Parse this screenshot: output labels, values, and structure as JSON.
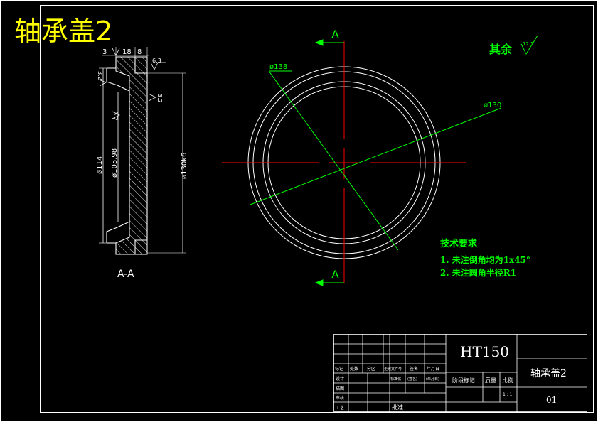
{
  "title": "轴承盖2",
  "colors": {
    "background": "#000000",
    "line": "#ffffff",
    "center": "#ff0000",
    "dim": "#00ff00",
    "title": "#ffff00"
  },
  "section_view": {
    "label": "A-A",
    "dims_top": [
      "3",
      "18",
      "8"
    ],
    "roughness_top": "6.3",
    "roughness_left": "3.2",
    "roughness_mid": "3.2",
    "roughness_right": "3.2",
    "dim_114": "ø114",
    "dim_105": "ø105.98",
    "dim_130": "ø130k6"
  },
  "front_view": {
    "section_mark": "A",
    "dim_138": "ø138",
    "dim_130": "ø130"
  },
  "roughness_note": {
    "label": "其余",
    "value": "12.5"
  },
  "tech_req": {
    "heading": "技术要求",
    "items": [
      "1. 未注倒角均为1x45°",
      "2. 未注圆角半径R1"
    ]
  },
  "title_block": {
    "material": "HT150",
    "part_name": "轴承盖2",
    "drawing_no": "01",
    "scale": "1 : 1",
    "header_labels": [
      "标记",
      "处数",
      "分区",
      "更改文件号",
      "签名",
      "年月日"
    ],
    "row_labels": [
      "设计",
      "描图",
      "审核",
      "工艺"
    ],
    "std_label": "标准化",
    "sign_label": "(签名)",
    "date_label": "(年月日)",
    "approve_label": "批准",
    "stage_label": "阶段标记",
    "mass_label": "质量",
    "ratio_label": "比例"
  }
}
